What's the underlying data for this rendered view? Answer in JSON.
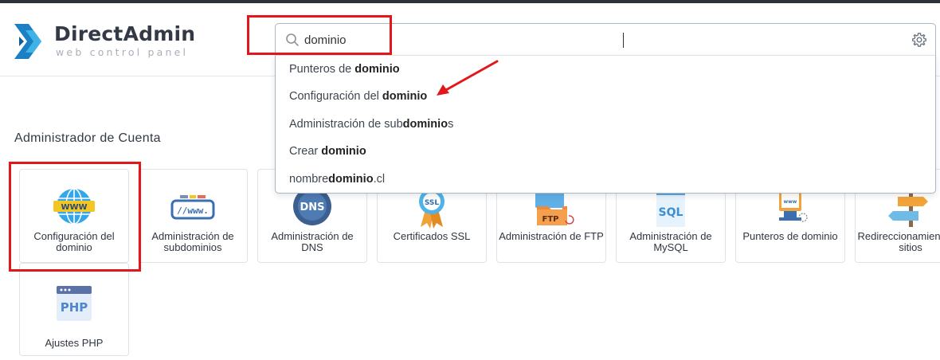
{
  "brand": {
    "name": "DirectAdmin",
    "tagline": "web control panel"
  },
  "search": {
    "value": "dominio",
    "placeholder": ""
  },
  "suggestions": [
    {
      "pre": "Punteros de ",
      "match": "dominio",
      "post": ""
    },
    {
      "pre": "Configuración del ",
      "match": "dominio",
      "post": ""
    },
    {
      "pre": "Administración de sub",
      "match": "dominio",
      "post": "s"
    },
    {
      "pre": "Crear ",
      "match": "dominio",
      "post": ""
    },
    {
      "pre": "nombre",
      "match": "dominio",
      "post": ".cl"
    }
  ],
  "section_title": "Administrador de Cuenta",
  "cards": [
    {
      "label": "Configuración del dominio",
      "icon": "globe-www-icon"
    },
    {
      "label": "Administración de subdominios",
      "icon": "subdomain-www-icon"
    },
    {
      "label": "Administración de DNS",
      "icon": "dns-icon"
    },
    {
      "label": "Certificados SSL",
      "icon": "ssl-badge-icon"
    },
    {
      "label": "Administración de FTP",
      "icon": "ftp-folder-icon"
    },
    {
      "label": "Administración de MySQL",
      "icon": "sql-database-icon"
    },
    {
      "label": "Punteros de dominio",
      "icon": "domain-pointer-icon"
    },
    {
      "label": "Redireccionamiento de sitios",
      "icon": "signpost-icon"
    },
    {
      "label": "Ajustes PHP",
      "icon": "php-window-icon"
    }
  ],
  "colors": {
    "annotation": "#e5161b",
    "accent": "#1a9ad6"
  }
}
